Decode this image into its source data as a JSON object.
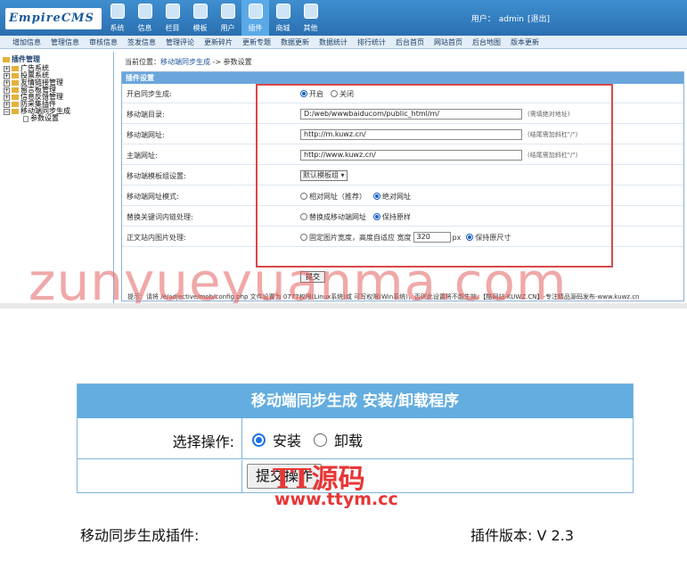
{
  "admin": {
    "logo": "EmpireCMS",
    "top_nav": [
      "系统",
      "信息",
      "栏目",
      "模板",
      "用户",
      "插件",
      "商城",
      "其他"
    ],
    "active_top": "插件",
    "user_label": "用户：",
    "user_name": "admin",
    "logout": "[退出]",
    "sub_nav": [
      "增加信息",
      "管理信息",
      "审核信息",
      "签发信息",
      "管理评论",
      "更新碎片",
      "更新专题",
      "数据更新",
      "数据统计",
      "排行统计",
      "后台首页",
      "网站首页",
      "后台地图",
      "版本更新"
    ],
    "sidebar": {
      "root": "插件管理",
      "items": [
        "广告系统",
        "投票系统",
        "友情链接管理",
        "留言板管理",
        "信息反馈管理",
        "防采集插件",
        "移动端同步生成"
      ],
      "child": "参数设置"
    },
    "breadcrumb": {
      "prefix": "当前位置：",
      "link": "移动端同步生成",
      "suffix": " -> 参数设置"
    },
    "panel_title": "插件设置",
    "rows": {
      "sync_label": "开启同步生成:",
      "sync_on": "开启",
      "sync_off": "关闭",
      "dir_label": "移动端目录:",
      "dir_value": "D:/web/wwwbaiducom/public_html/m/",
      "dir_hint": "(需填绝对地址)",
      "mobile_url_label": "移动端网址:",
      "mobile_url_value": "http://m.kuwz.cn/",
      "mobile_url_hint": "(结尾需加斜杠\"/\")",
      "main_url_label": "主端网址:",
      "main_url_value": "http://www.kuwz.cn/",
      "main_url_hint": "(结尾需加斜杠\"/\")",
      "tpl_label": "移动端模板组设置:",
      "tpl_value": "默认模板组",
      "url_mode_label": "移动端网址模式:",
      "url_mode_rel": "相对网址（推荐）",
      "url_mode_abs": "绝对网址",
      "kw_label": "替换关键词内链处理:",
      "kw_replace": "替换成移动端网址",
      "kw_keep": "保持原样",
      "img_label": "正文站内图片处理:",
      "img_fixed": "固定图片宽度，高度自适应 宽度",
      "img_width": "320",
      "img_unit": "px",
      "img_keep": "保持原尺寸",
      "submit": "提交"
    },
    "tip": "提示：请将 /e/adjective/mob/config.php 文件设置为 0777权限(Linux系统)或 可写权限(Win系统)，否则此设置将不能生效。【酷网站-KUWZ.CN】-专注精品源码发布-www.kuwz.cn",
    "watermark": "zunyueyuanma.com"
  },
  "installer": {
    "title": "移动端同步生成 安装/卸载程序",
    "op_label": "选择操作:",
    "opt_install": "安装",
    "opt_uninstall": "卸载",
    "selected": "安装",
    "submit": "提交操作",
    "plugin_label": "移动同步生成插件:",
    "version_label": "插件版本: V 2.3",
    "watermark_main": "TT源码",
    "watermark_url": "www.ttym.cc"
  }
}
